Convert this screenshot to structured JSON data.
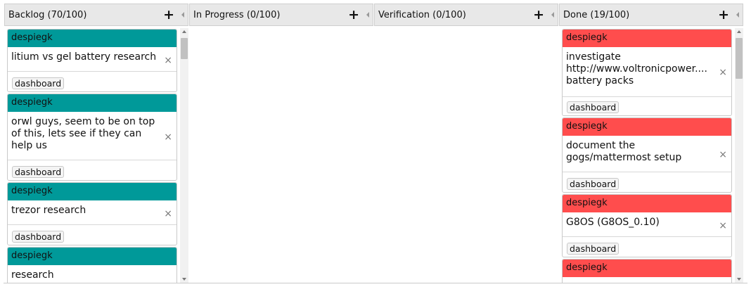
{
  "columns": [
    {
      "title": "Backlog (70/100)",
      "add_icon": "plus-icon",
      "collapse_icon": "collapse-left-icon",
      "owner_color": "#009999",
      "cards": [
        {
          "owner": "despiegk",
          "text": "litium vs gel battery research",
          "tag": "dashboard"
        },
        {
          "owner": "despiegk",
          "text": "orwl guys, seem to be on top of this, lets see if they can help us",
          "tag": "dashboard"
        },
        {
          "owner": "despiegk",
          "text": "trezor research",
          "tag": "dashboard"
        },
        {
          "owner": "despiegk",
          "text": "research",
          "tag": ""
        }
      ]
    },
    {
      "title": "In Progress (0/100)",
      "add_icon": "plus-icon",
      "collapse_icon": "collapse-left-icon",
      "cards": []
    },
    {
      "title": "Verification (0/100)",
      "add_icon": "plus-icon",
      "collapse_icon": "collapse-left-icon",
      "cards": []
    },
    {
      "title": "Done (19/100)",
      "add_icon": "plus-icon",
      "collapse_icon": "collapse-left-icon",
      "owner_color": "#ff4d4d",
      "cards": [
        {
          "owner": "despiegk",
          "text": "investigate http://www.voltronicpower.... battery packs",
          "tag": "dashboard"
        },
        {
          "owner": "despiegk",
          "text": "document the gogs/mattermost setup",
          "tag": "dashboard"
        },
        {
          "owner": "despiegk",
          "text": "G8OS (G8OS_0.10)",
          "tag": "dashboard"
        },
        {
          "owner": "despiegk",
          "text": "",
          "tag": ""
        }
      ]
    }
  ],
  "card_close_glyph": "×",
  "add_glyph": "+",
  "colors": {
    "backlog_owner": "#009999",
    "done_owner": "#ff4d4d",
    "header_bg": "#e8e8e8"
  }
}
